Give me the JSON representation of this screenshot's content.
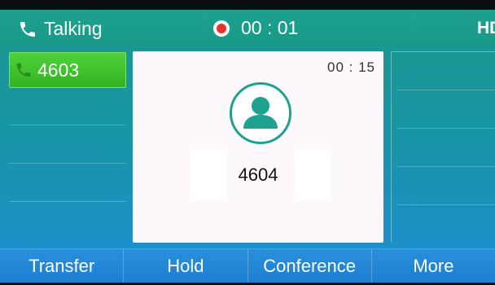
{
  "status_bar": {
    "state_label": "Talking",
    "recording_time": "00 : 01",
    "hd_label": "HD"
  },
  "line_keys": [
    {
      "label": "4603",
      "active": true,
      "icon": "phone-handset-icon"
    }
  ],
  "call_card": {
    "timer": "00 : 15",
    "callee_number": "4604",
    "avatar_icon": "contact-avatar-icon"
  },
  "softkeys": [
    {
      "label": "Transfer"
    },
    {
      "label": "Hold"
    },
    {
      "label": "Conference"
    },
    {
      "label": "More"
    }
  ],
  "colors": {
    "accent_teal": "#1ea18f",
    "active_line_green": "#3fc22b",
    "recording_red": "#e8322c",
    "softkey_blue": "#2a8fdc"
  }
}
